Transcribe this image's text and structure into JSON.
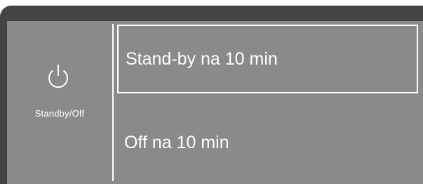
{
  "panel": {
    "power_label": "Standby/Off",
    "power_icon": "power-icon"
  },
  "options": [
    {
      "label": "Stand-by na 10 min",
      "selected": true
    },
    {
      "label": "Off na 10 min",
      "selected": false
    }
  ],
  "colors": {
    "frame": "#444444",
    "screen": "#8a8a8a",
    "text": "#ffffff"
  }
}
